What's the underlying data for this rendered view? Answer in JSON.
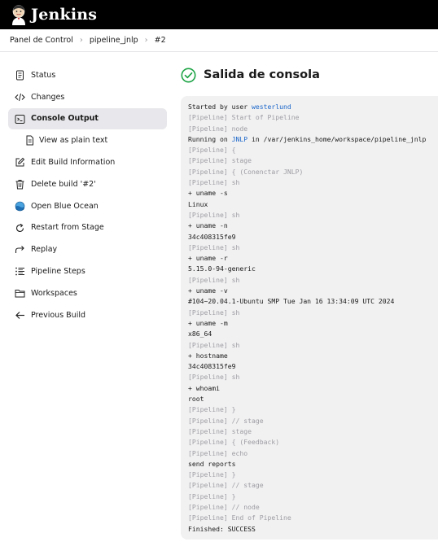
{
  "header": {
    "brand": "Jenkins"
  },
  "breadcrumb": [
    "Panel de Control",
    "pipeline_jnlp",
    "#2"
  ],
  "sidebar": {
    "items": [
      {
        "label": "Status",
        "icon": "document-icon"
      },
      {
        "label": "Changes",
        "icon": "code-icon"
      },
      {
        "label": "Console Output",
        "icon": "terminal-icon"
      },
      {
        "label": "View as plain text",
        "icon": "document-icon"
      },
      {
        "label": "Edit Build Information",
        "icon": "edit-icon"
      },
      {
        "label": "Delete build '#2'",
        "icon": "trash-icon"
      },
      {
        "label": "Open Blue Ocean",
        "icon": "blue-ocean-icon"
      },
      {
        "label": "Restart from Stage",
        "icon": "restart-icon"
      },
      {
        "label": "Replay",
        "icon": "replay-icon"
      },
      {
        "label": "Pipeline Steps",
        "icon": "list-icon"
      },
      {
        "label": "Workspaces",
        "icon": "folder-icon"
      },
      {
        "label": "Previous Build",
        "icon": "arrow-left-icon"
      }
    ]
  },
  "main": {
    "title": "Salida de consola",
    "status_color": "#1ea446"
  },
  "console": {
    "lines": [
      {
        "text": "Started by user ",
        "link": "westerlund"
      },
      {
        "text": "[Pipeline] Start of Pipeline",
        "muted": true
      },
      {
        "text": "[Pipeline] node",
        "muted": true
      },
      {
        "text": "Running on ",
        "link": "JNLP",
        "tail": " in /var/jenkins_home/workspace/pipeline_jnlp"
      },
      {
        "text": "[Pipeline] {",
        "muted": true
      },
      {
        "text": "[Pipeline] stage",
        "muted": true
      },
      {
        "text": "[Pipeline] { (Conenctar JNLP)",
        "muted": true
      },
      {
        "text": "[Pipeline] sh",
        "muted": true
      },
      {
        "text": "+ uname -s"
      },
      {
        "text": "Linux"
      },
      {
        "text": "[Pipeline] sh",
        "muted": true
      },
      {
        "text": "+ uname -n"
      },
      {
        "text": "34c408315fe9"
      },
      {
        "text": "[Pipeline] sh",
        "muted": true
      },
      {
        "text": "+ uname -r"
      },
      {
        "text": "5.15.0-94-generic"
      },
      {
        "text": "[Pipeline] sh",
        "muted": true
      },
      {
        "text": "+ uname -v"
      },
      {
        "text": "#104~20.04.1-Ubuntu SMP Tue Jan 16 13:34:09 UTC 2024"
      },
      {
        "text": "[Pipeline] sh",
        "muted": true
      },
      {
        "text": "+ uname -m"
      },
      {
        "text": "x86_64"
      },
      {
        "text": "[Pipeline] sh",
        "muted": true
      },
      {
        "text": "+ hostname"
      },
      {
        "text": "34c408315fe9"
      },
      {
        "text": "[Pipeline] sh",
        "muted": true
      },
      {
        "text": "+ whoami"
      },
      {
        "text": "root"
      },
      {
        "text": "[Pipeline] }",
        "muted": true
      },
      {
        "text": "[Pipeline] // stage",
        "muted": true
      },
      {
        "text": "[Pipeline] stage",
        "muted": true
      },
      {
        "text": "[Pipeline] { (Feedback)",
        "muted": true
      },
      {
        "text": "[Pipeline] echo",
        "muted": true
      },
      {
        "text": "send reports"
      },
      {
        "text": "[Pipeline] }",
        "muted": true
      },
      {
        "text": "[Pipeline] // stage",
        "muted": true
      },
      {
        "text": "[Pipeline] }",
        "muted": true
      },
      {
        "text": "[Pipeline] // node",
        "muted": true
      },
      {
        "text": "[Pipeline] End of Pipeline",
        "muted": true
      },
      {
        "text": "Finished: SUCCESS"
      }
    ]
  }
}
